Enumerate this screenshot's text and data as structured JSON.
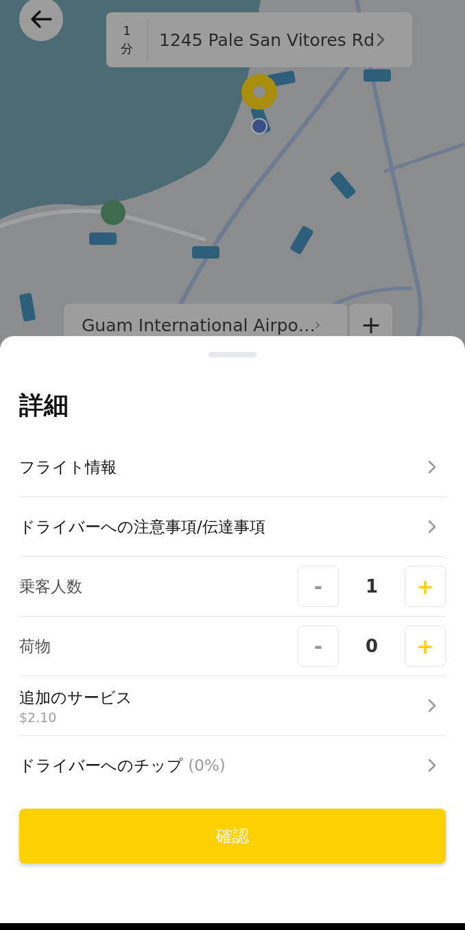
{
  "map": {
    "kind": "picture",
    "eta": {
      "value": "1",
      "unit": "分"
    },
    "pickup": "1245 Pale San Vitores Rd",
    "dropoff": "Guam International Airpo…",
    "add_stop": "+"
  },
  "sheet": {
    "title": "詳細",
    "rows": [
      {
        "kind": "link",
        "label": "フライト情報"
      },
      {
        "kind": "link",
        "label": "ドライバーへの注意事項/伝達事項"
      },
      {
        "kind": "counter",
        "label": "乗客人数",
        "minus": "-",
        "value": "1",
        "plus": "+"
      },
      {
        "kind": "counter",
        "label": "荷物",
        "minus": "-",
        "value": "0",
        "plus": "+"
      },
      {
        "kind": "link",
        "label": "追加のサービス",
        "sub": "$2.10"
      },
      {
        "kind": "link",
        "label": "ドライバーへのチップ",
        "suffix": "(0%)"
      }
    ],
    "confirm": "確認"
  }
}
